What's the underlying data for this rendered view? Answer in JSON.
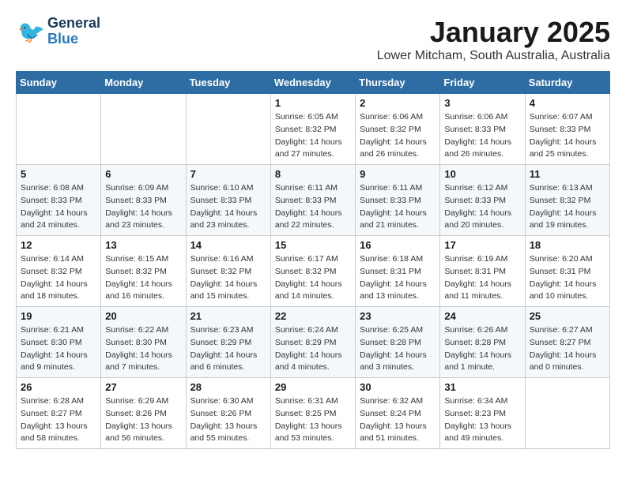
{
  "header": {
    "logo_line1": "General",
    "logo_line2": "Blue",
    "main_title": "January 2025",
    "subtitle": "Lower Mitcham, South Australia, Australia"
  },
  "days_of_week": [
    "Sunday",
    "Monday",
    "Tuesday",
    "Wednesday",
    "Thursday",
    "Friday",
    "Saturday"
  ],
  "weeks": [
    [
      {
        "day": "",
        "info": ""
      },
      {
        "day": "",
        "info": ""
      },
      {
        "day": "",
        "info": ""
      },
      {
        "day": "1",
        "info": "Sunrise: 6:05 AM\nSunset: 8:32 PM\nDaylight: 14 hours\nand 27 minutes."
      },
      {
        "day": "2",
        "info": "Sunrise: 6:06 AM\nSunset: 8:32 PM\nDaylight: 14 hours\nand 26 minutes."
      },
      {
        "day": "3",
        "info": "Sunrise: 6:06 AM\nSunset: 8:33 PM\nDaylight: 14 hours\nand 26 minutes."
      },
      {
        "day": "4",
        "info": "Sunrise: 6:07 AM\nSunset: 8:33 PM\nDaylight: 14 hours\nand 25 minutes."
      }
    ],
    [
      {
        "day": "5",
        "info": "Sunrise: 6:08 AM\nSunset: 8:33 PM\nDaylight: 14 hours\nand 24 minutes."
      },
      {
        "day": "6",
        "info": "Sunrise: 6:09 AM\nSunset: 8:33 PM\nDaylight: 14 hours\nand 23 minutes."
      },
      {
        "day": "7",
        "info": "Sunrise: 6:10 AM\nSunset: 8:33 PM\nDaylight: 14 hours\nand 23 minutes."
      },
      {
        "day": "8",
        "info": "Sunrise: 6:11 AM\nSunset: 8:33 PM\nDaylight: 14 hours\nand 22 minutes."
      },
      {
        "day": "9",
        "info": "Sunrise: 6:11 AM\nSunset: 8:33 PM\nDaylight: 14 hours\nand 21 minutes."
      },
      {
        "day": "10",
        "info": "Sunrise: 6:12 AM\nSunset: 8:33 PM\nDaylight: 14 hours\nand 20 minutes."
      },
      {
        "day": "11",
        "info": "Sunrise: 6:13 AM\nSunset: 8:32 PM\nDaylight: 14 hours\nand 19 minutes."
      }
    ],
    [
      {
        "day": "12",
        "info": "Sunrise: 6:14 AM\nSunset: 8:32 PM\nDaylight: 14 hours\nand 18 minutes."
      },
      {
        "day": "13",
        "info": "Sunrise: 6:15 AM\nSunset: 8:32 PM\nDaylight: 14 hours\nand 16 minutes."
      },
      {
        "day": "14",
        "info": "Sunrise: 6:16 AM\nSunset: 8:32 PM\nDaylight: 14 hours\nand 15 minutes."
      },
      {
        "day": "15",
        "info": "Sunrise: 6:17 AM\nSunset: 8:32 PM\nDaylight: 14 hours\nand 14 minutes."
      },
      {
        "day": "16",
        "info": "Sunrise: 6:18 AM\nSunset: 8:31 PM\nDaylight: 14 hours\nand 13 minutes."
      },
      {
        "day": "17",
        "info": "Sunrise: 6:19 AM\nSunset: 8:31 PM\nDaylight: 14 hours\nand 11 minutes."
      },
      {
        "day": "18",
        "info": "Sunrise: 6:20 AM\nSunset: 8:31 PM\nDaylight: 14 hours\nand 10 minutes."
      }
    ],
    [
      {
        "day": "19",
        "info": "Sunrise: 6:21 AM\nSunset: 8:30 PM\nDaylight: 14 hours\nand 9 minutes."
      },
      {
        "day": "20",
        "info": "Sunrise: 6:22 AM\nSunset: 8:30 PM\nDaylight: 14 hours\nand 7 minutes."
      },
      {
        "day": "21",
        "info": "Sunrise: 6:23 AM\nSunset: 8:29 PM\nDaylight: 14 hours\nand 6 minutes."
      },
      {
        "day": "22",
        "info": "Sunrise: 6:24 AM\nSunset: 8:29 PM\nDaylight: 14 hours\nand 4 minutes."
      },
      {
        "day": "23",
        "info": "Sunrise: 6:25 AM\nSunset: 8:28 PM\nDaylight: 14 hours\nand 3 minutes."
      },
      {
        "day": "24",
        "info": "Sunrise: 6:26 AM\nSunset: 8:28 PM\nDaylight: 14 hours\nand 1 minute."
      },
      {
        "day": "25",
        "info": "Sunrise: 6:27 AM\nSunset: 8:27 PM\nDaylight: 14 hours\nand 0 minutes."
      }
    ],
    [
      {
        "day": "26",
        "info": "Sunrise: 6:28 AM\nSunset: 8:27 PM\nDaylight: 13 hours\nand 58 minutes."
      },
      {
        "day": "27",
        "info": "Sunrise: 6:29 AM\nSunset: 8:26 PM\nDaylight: 13 hours\nand 56 minutes."
      },
      {
        "day": "28",
        "info": "Sunrise: 6:30 AM\nSunset: 8:26 PM\nDaylight: 13 hours\nand 55 minutes."
      },
      {
        "day": "29",
        "info": "Sunrise: 6:31 AM\nSunset: 8:25 PM\nDaylight: 13 hours\nand 53 minutes."
      },
      {
        "day": "30",
        "info": "Sunrise: 6:32 AM\nSunset: 8:24 PM\nDaylight: 13 hours\nand 51 minutes."
      },
      {
        "day": "31",
        "info": "Sunrise: 6:34 AM\nSunset: 8:23 PM\nDaylight: 13 hours\nand 49 minutes."
      },
      {
        "day": "",
        "info": ""
      }
    ]
  ]
}
